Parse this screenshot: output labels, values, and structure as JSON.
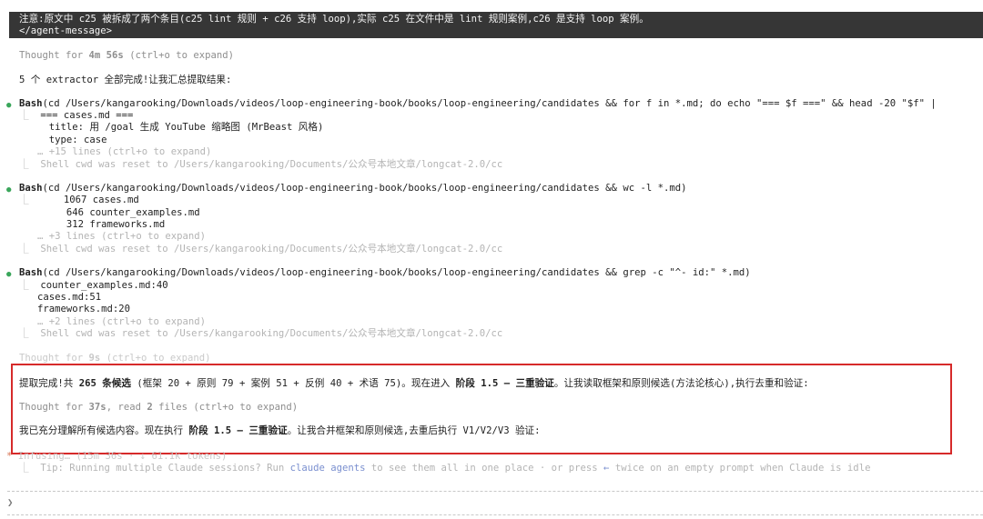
{
  "banner": {
    "line1": "注意:原文中 c25 被拆成了两个条目(c25 lint 规则 + c26 支持 loop),实际 c25 在文件中是 lint 规则案例,c26 是支持 loop 案例。",
    "line2": "</agent-message>"
  },
  "thought1": {
    "prefix": "Thought for ",
    "duration": "4m 56s",
    "suffix": " (ctrl+o to expand)"
  },
  "summary_line": "5 个 extractor 全部完成!让我汇总提取结果:",
  "bash1": {
    "tool": "Bash",
    "command": "(cd /Users/kangarooking/Downloads/videos/loop-engineering-book/books/loop-engineering/candidates && for f in *.md; do echo \"=== $f ===\" && head -20 \"$f\" |",
    "out": [
      "=== cases.md ===",
      "  title: 用 /goal 生成 YouTube 缩略图 (MrBeast 风格)",
      "  type: case"
    ],
    "more": "… +15 lines (ctrl+o to expand)",
    "cwd": "Shell cwd was reset to /Users/kangarooking/Documents/公众号本地文章/longcat-2.0/cc"
  },
  "bash2": {
    "tool": "Bash",
    "command": "(cd /Users/kangarooking/Downloads/videos/loop-engineering-book/books/loop-engineering/candidates && wc -l *.md)",
    "out": [
      "    1067 cases.md",
      "     646 counter_examples.md",
      "     312 frameworks.md"
    ],
    "more": "… +3 lines (ctrl+o to expand)",
    "cwd": "Shell cwd was reset to /Users/kangarooking/Documents/公众号本地文章/longcat-2.0/cc"
  },
  "bash3": {
    "tool": "Bash",
    "command": "(cd /Users/kangarooking/Downloads/videos/loop-engineering-book/books/loop-engineering/candidates && grep -c \"^- id:\" *.md)",
    "out": [
      "counter_examples.md:40",
      "cases.md:51",
      "frameworks.md:20"
    ],
    "more": "… +2 lines (ctrl+o to expand)",
    "cwd": "Shell cwd was reset to /Users/kangarooking/Documents/公众号本地文章/longcat-2.0/cc"
  },
  "thought2": {
    "prefix": "Thought for ",
    "duration": "9s",
    "suffix": " (ctrl+o to expand)"
  },
  "highlight": {
    "l1_a": "提取完成!共 ",
    "l1_b": "265 条候选",
    "l1_c": " (框架 20 + 原则 79 + 案例 51 + 反例 40 + 术语 75)。现在进入 ",
    "l1_d": "阶段 1.5 — 三重验证",
    "l1_e": "。让我读取框架和原则候选(方法论核心),执行去重和验证:",
    "thought_prefix": "Thought for ",
    "thought_dur": "37s",
    "thought_mid": ", read ",
    "thought_files": "2",
    "thought_suffix": " files (ctrl+o to expand)",
    "l3_a": "我已充分理解所有候选内容。现在执行 ",
    "l3_b": "阶段 1.5 — 三重验证",
    "l3_c": "。让我合并框架和原则候选,去重后执行 V1/V2/V3 验证:"
  },
  "status": {
    "star": "*",
    "text": " Infusing… (15m 36s · ↓ 61.1k tokens)"
  },
  "tip": {
    "prefix": "Tip: Running multiple Claude sessions? Run ",
    "link": "claude agents",
    "mid": " to see them all in one place · or press ",
    "arrow": "←",
    "suffix": " twice on an empty prompt when Claude is idle"
  },
  "prompt_symbol": "❯"
}
